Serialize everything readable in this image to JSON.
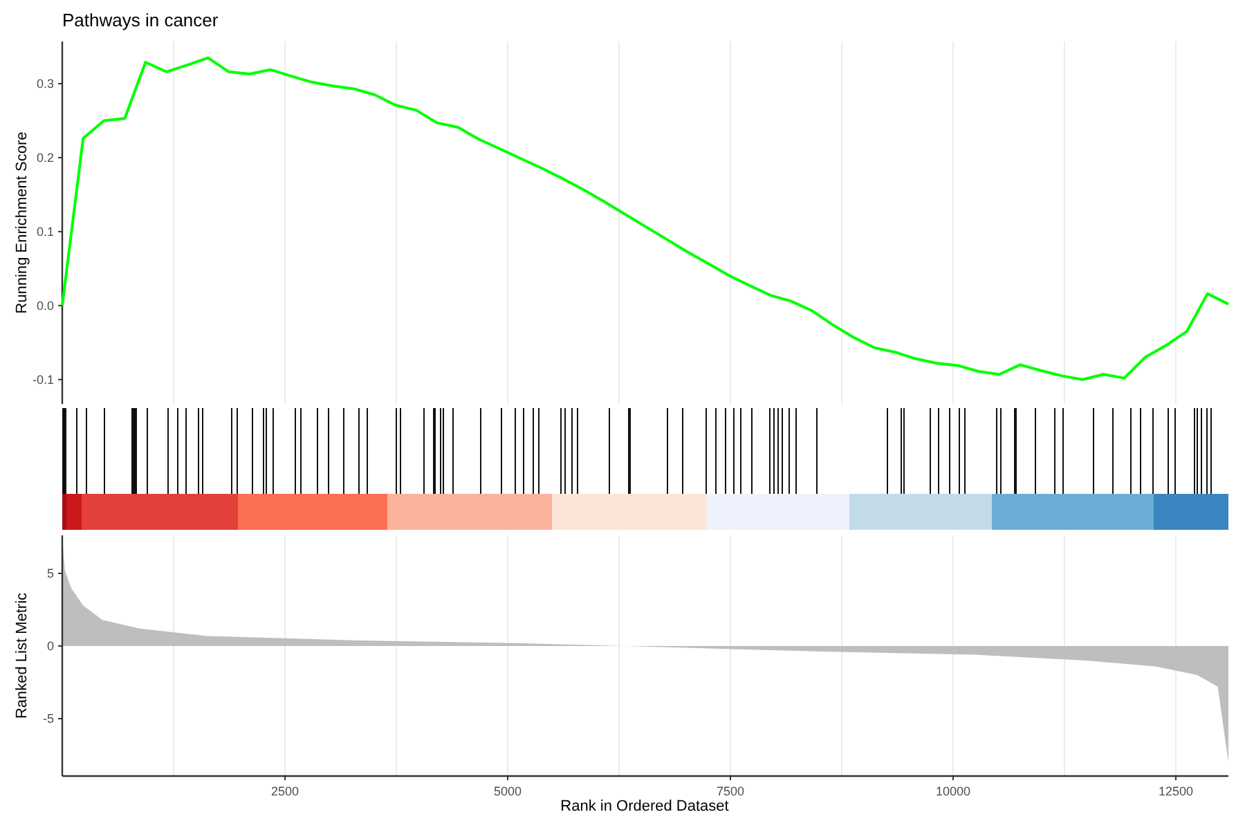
{
  "enrichment_plot": {
    "chart_data": {
      "type": "line",
      "title": "Pathways in cancer",
      "ylabel": "Running Enrichment Score",
      "ylim": [
        -0.133,
        0.357
      ],
      "grid": true,
      "yticks": [
        {
          "value": -0.1,
          "label": "-0.1"
        },
        {
          "value": 0,
          "label": "0.0"
        },
        {
          "value": 0.1,
          "label": "0.1"
        },
        {
          "value": 0.2,
          "label": "0.2"
        },
        {
          "value": 0.3,
          "label": "0.3"
        }
      ],
      "series": [
        {
          "color": "#00ff00",
          "values": [
            0,
            0.226,
            0.25,
            0.253,
            0.329,
            0.316,
            0.325,
            0.335,
            0.316,
            0.313,
            0.319,
            0.31,
            0.302,
            0.297,
            0.293,
            0.285,
            0.271,
            0.264,
            0.247,
            0.241,
            0.225,
            0.212,
            0.199,
            0.186,
            0.172,
            0.157,
            0.141,
            0.124,
            0.107,
            0.09,
            0.073,
            0.057,
            0.041,
            0.027,
            0.014,
            0.006,
            -0.007,
            -0.026,
            -0.043,
            -0.057,
            -0.063,
            -0.072,
            -0.078,
            -0.081,
            -0.089,
            -0.093,
            -0.08,
            -0.088,
            -0.095,
            -0.1,
            -0.093,
            -0.098,
            -0.07,
            -0.054,
            -0.035,
            0.016,
            0.002
          ]
        }
      ]
    }
  },
  "metric_plot": {
    "chart_data": {
      "type": "area",
      "xlabel": "Rank in Ordered Dataset",
      "ylabel": "Ranked List Metric",
      "xlim": [
        0,
        13090
      ],
      "ylim": [
        -8.95,
        7.62
      ],
      "grid": true,
      "xticks": [
        2500,
        5000,
        7500,
        10000,
        12500
      ],
      "yticks": [
        {
          "value": -5,
          "label": "-5"
        },
        {
          "value": 0,
          "label": "0"
        },
        {
          "value": 5,
          "label": "5"
        }
      ],
      "x": [
        0,
        30,
        100,
        233,
        450,
        870,
        1630,
        3210,
        5080,
        6320,
        7450,
        8690,
        10240,
        11490,
        12270,
        12740,
        12970,
        13090
      ],
      "series": [
        {
          "color": "#bebebe",
          "values": [
            7.5,
            5.2,
            4,
            2.8,
            1.8,
            1.2,
            0.7,
            0.4,
            0.2,
            0,
            -0.2,
            -0.4,
            -0.6,
            -1,
            -1.4,
            -2,
            -2.8,
            -8
          ]
        }
      ]
    }
  }
}
